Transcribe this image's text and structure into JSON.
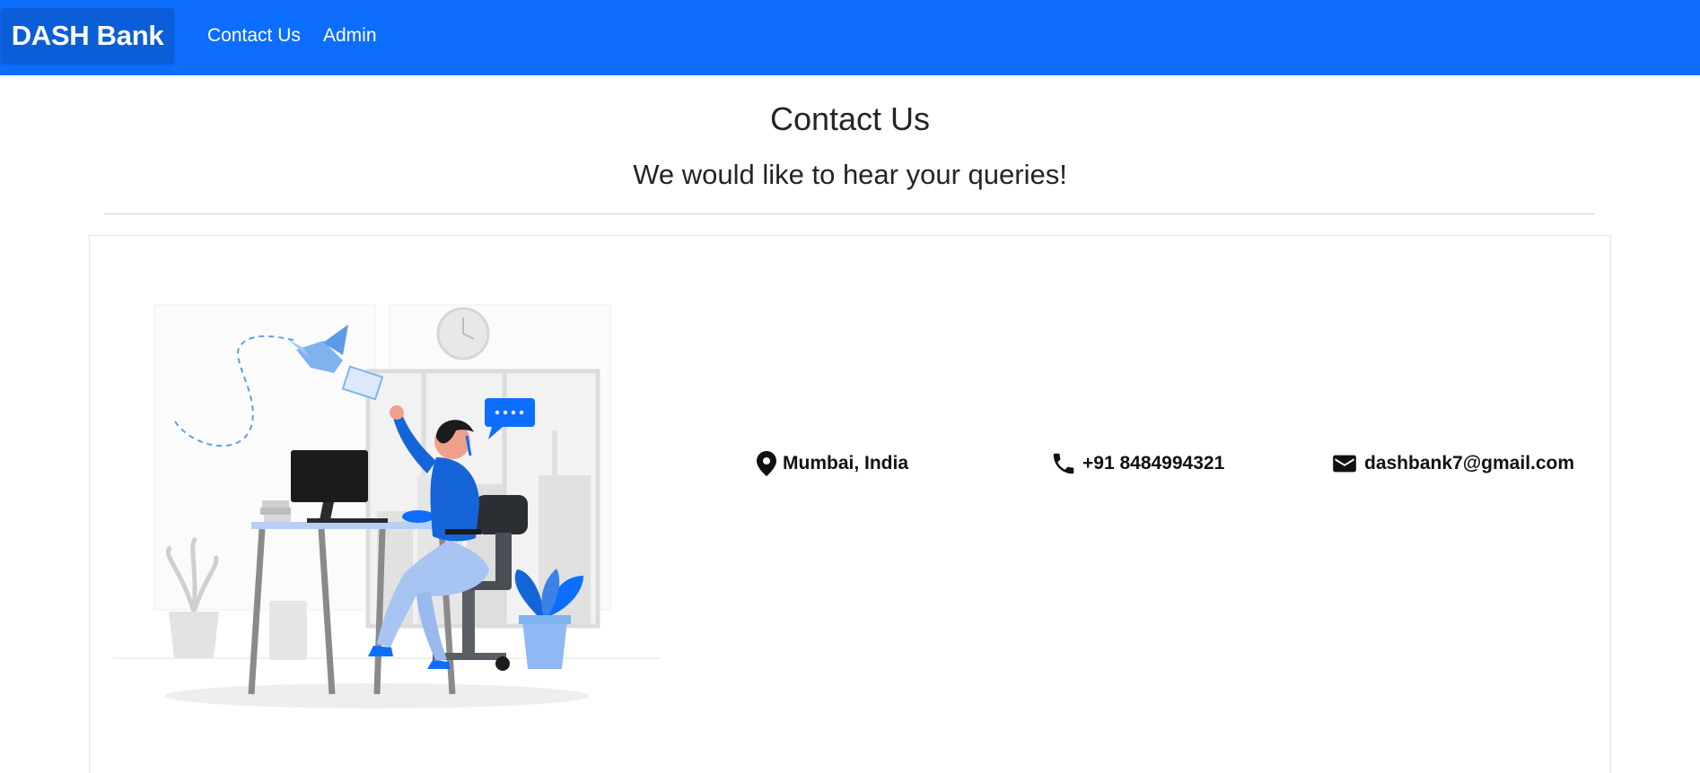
{
  "navbar": {
    "brand": "DASH Bank",
    "links": [
      {
        "label": "Contact Us"
      },
      {
        "label": "Admin"
      }
    ],
    "color": "#0d6efd"
  },
  "header": {
    "title": "Contact Us",
    "subtitle": "We would like to hear your queries!"
  },
  "contact": {
    "location": {
      "text": "Mumbai, India",
      "icon": "location-pin-icon"
    },
    "phone": {
      "text": "+91 8484994321",
      "icon": "phone-icon"
    },
    "email": {
      "text": "dashbank7@gmail.com",
      "icon": "envelope-icon"
    }
  },
  "illustration": {
    "subject": "customer-support-illustration",
    "accent": "#1a73e8"
  }
}
